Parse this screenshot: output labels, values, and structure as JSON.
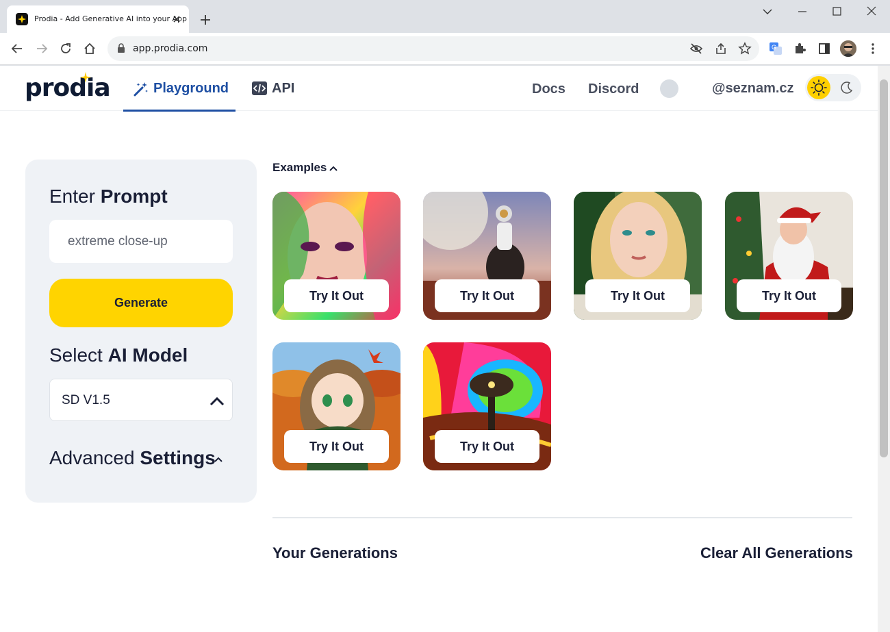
{
  "browser": {
    "tab_title": "Prodia - Add Generative AI into your App",
    "url": "app.prodia.com"
  },
  "site": {
    "logo_text": "prodia",
    "nav": {
      "playground": "Playground",
      "api": "API",
      "docs": "Docs",
      "discord": "Discord"
    },
    "user_email": "@seznam.cz",
    "theme": "light"
  },
  "panel": {
    "prompt_heading_prefix": "Enter ",
    "prompt_heading_bold": "Prompt",
    "prompt_value": "extreme close-up",
    "generate_label": "Generate",
    "model_heading_prefix": "Select ",
    "model_heading_bold": "AI Model",
    "model_value": "SD V1.5",
    "advanced_prefix": "Advanced ",
    "advanced_bold": "Settings"
  },
  "examples": {
    "toggle_label": "Examples",
    "cards": [
      {
        "label": "Try It Out",
        "image": "colorful-woman-portrait"
      },
      {
        "label": "Try It Out",
        "image": "astronaut-on-horse"
      },
      {
        "label": "Try It Out",
        "image": "blonde-woman-portrait"
      },
      {
        "label": "Try It Out",
        "image": "santa-claus"
      },
      {
        "label": "Try It Out",
        "image": "anime-girl-autumn"
      },
      {
        "label": "Try It Out",
        "image": "psychedelic-tree"
      }
    ]
  },
  "generations": {
    "title": "Your Generations",
    "clear_label": "Clear All Generations"
  },
  "colors": {
    "accent_yellow": "#ffd400",
    "nav_active": "#1e4fa3",
    "panel_bg": "#eff2f6"
  }
}
